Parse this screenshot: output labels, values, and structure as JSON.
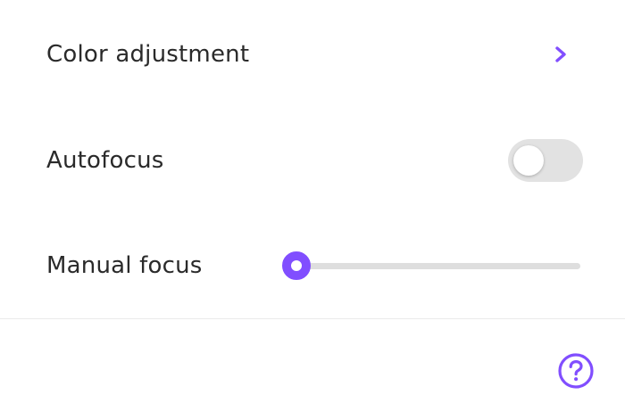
{
  "settings": {
    "color_adjustment": {
      "label": "Color adjustment",
      "icon": "chevron-right-icon"
    },
    "autofocus": {
      "label": "Autofocus",
      "enabled": false
    },
    "manual_focus": {
      "label": "Manual focus",
      "value_fraction": 0.0
    }
  },
  "footer": {
    "help_icon": "help-circle-icon"
  },
  "colors": {
    "accent": "#814eff",
    "toggle_off": "#e2e2e2",
    "track": "#dedede",
    "text": "#2a2a2a",
    "divider": "#ebebeb"
  }
}
